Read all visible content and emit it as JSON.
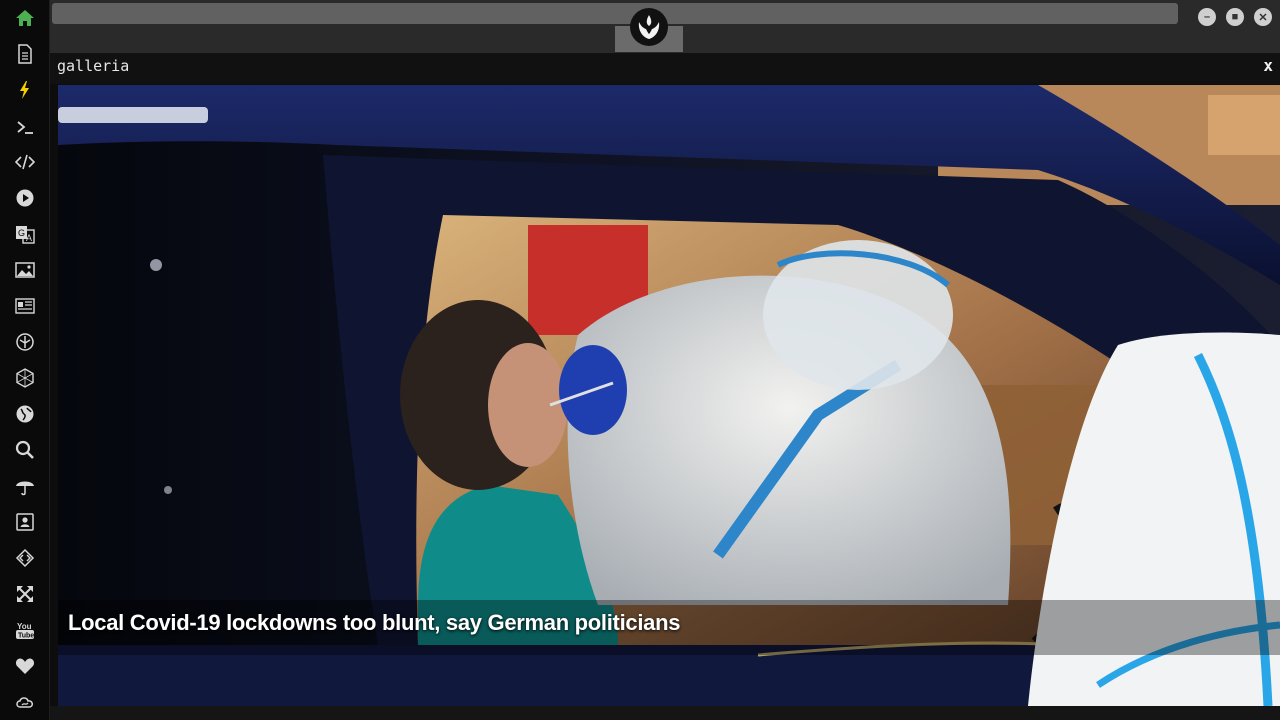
{
  "window": {
    "panel_title": "galleria",
    "close_label": "x",
    "minimize_icon": "minimize-icon",
    "maximize_icon": "maximize-icon",
    "close_window_icon": "close-window-icon"
  },
  "sidebar": {
    "items": [
      {
        "name": "home",
        "icon": "home-icon",
        "active": true
      },
      {
        "name": "document",
        "icon": "document-icon"
      },
      {
        "name": "lightning",
        "icon": "lightning-icon"
      },
      {
        "name": "terminal",
        "icon": "terminal-icon"
      },
      {
        "name": "code",
        "icon": "code-icon"
      },
      {
        "name": "play",
        "icon": "play-icon"
      },
      {
        "name": "translate",
        "icon": "translate-icon"
      },
      {
        "name": "image",
        "icon": "image-icon"
      },
      {
        "name": "news",
        "icon": "newspaper-icon"
      },
      {
        "name": "rebel",
        "icon": "rebel-alliance-icon"
      },
      {
        "name": "hexagon",
        "icon": "hexagon-icon"
      },
      {
        "name": "globe",
        "icon": "globe-icon"
      },
      {
        "name": "search",
        "icon": "search-icon"
      },
      {
        "name": "weather",
        "icon": "umbrella-icon"
      },
      {
        "name": "contacts",
        "icon": "contacts-icon"
      },
      {
        "name": "code-diamond",
        "icon": "code-diamond-icon"
      },
      {
        "name": "expand",
        "icon": "expand-icon"
      },
      {
        "name": "youtube",
        "icon": "youtube-icon"
      },
      {
        "name": "favorites",
        "icon": "heart-icon"
      },
      {
        "name": "cloud",
        "icon": "cloud-icon"
      }
    ]
  },
  "gallery": {
    "caption": "Local Covid-19 lockdowns too blunt, say German politicians"
  },
  "colors": {
    "accent": "#4caf50",
    "background": "#0d0d0d",
    "topbar": "#2a2a2a"
  }
}
